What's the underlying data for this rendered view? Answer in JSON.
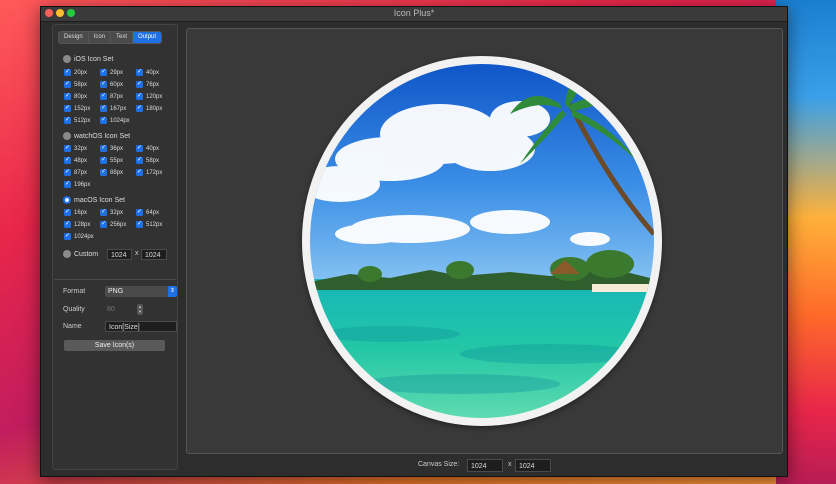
{
  "window": {
    "title": "Icon Plus*"
  },
  "tabs": [
    "Design",
    "Icon",
    "Text",
    "Output"
  ],
  "ios": {
    "title": "iOS Icon Set",
    "sizes": [
      "20px",
      "29px",
      "40px",
      "58px",
      "60px",
      "76px",
      "80px",
      "87px",
      "120px",
      "152px",
      "167px",
      "180px",
      "512px",
      "1024px"
    ]
  },
  "watchos": {
    "title": "watchOS Icon Set",
    "sizes": [
      "32px",
      "36px",
      "40px",
      "48px",
      "55px",
      "58px",
      "87px",
      "88px",
      "172px",
      "196px"
    ]
  },
  "macos": {
    "title": "macOS Icon Set",
    "sizes": [
      "16px",
      "32px",
      "64px",
      "128px",
      "256px",
      "512px",
      "1024px"
    ]
  },
  "custom": {
    "label": "Custom",
    "width": "1024",
    "sep": "x",
    "height": "1024"
  },
  "output": {
    "format_label": "Format",
    "format_value": "PNG",
    "quality_label": "Quality",
    "quality_value": "80",
    "name_label": "Name",
    "name_value": "Icon[Size]",
    "save_button": "Save Icon(s)"
  },
  "canvas": {
    "label": "Canvas Size:",
    "width": "1024",
    "sep": "x",
    "height": "1024"
  }
}
